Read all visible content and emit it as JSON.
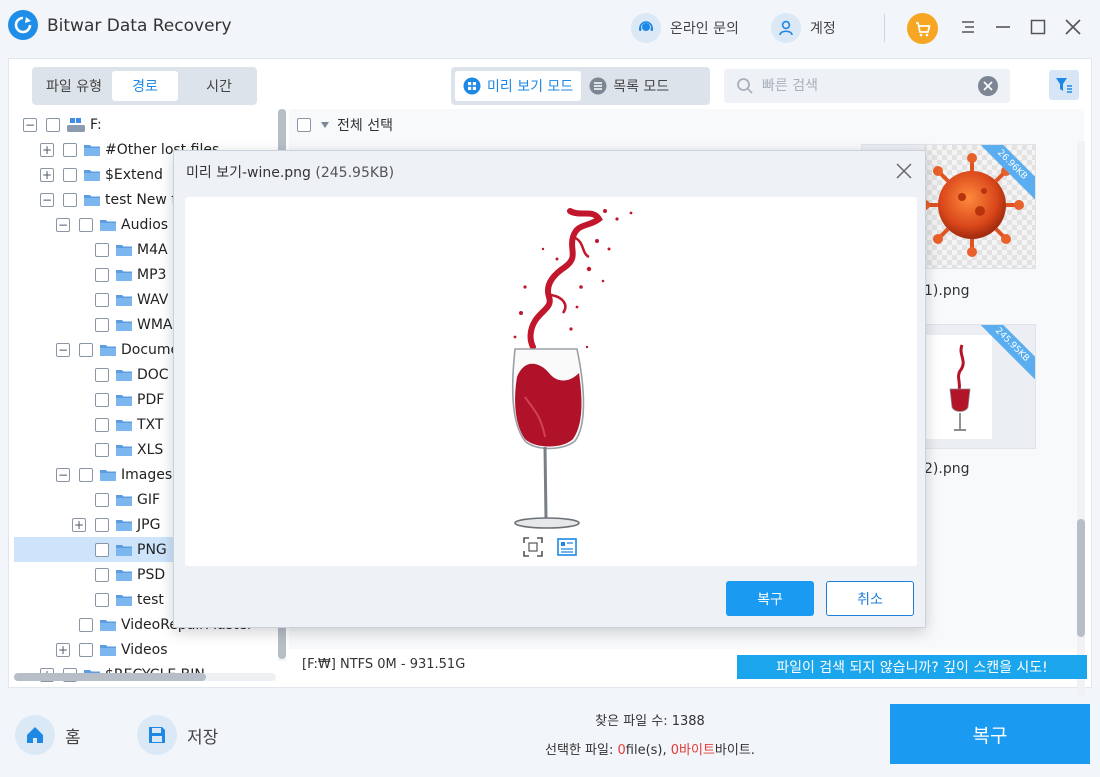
{
  "app": {
    "title": "Bitwar Data Recovery"
  },
  "header": {
    "online_inquiry": "온라인 문의",
    "account": "계정"
  },
  "left_panel": {
    "filter_label": "파일 유형",
    "tabs": [
      {
        "label": "경로"
      },
      {
        "label": "시간"
      }
    ]
  },
  "tree": {
    "items": [
      {
        "label": "F:"
      },
      {
        "label": "#Other lost files"
      },
      {
        "label": "$Extend"
      },
      {
        "label": "test New f"
      },
      {
        "label": "Audios"
      },
      {
        "label": "M4A"
      },
      {
        "label": "MP3"
      },
      {
        "label": "WAV"
      },
      {
        "label": "WMA"
      },
      {
        "label": "Docume"
      },
      {
        "label": "DOC"
      },
      {
        "label": "PDF"
      },
      {
        "label": "TXT"
      },
      {
        "label": "XLS"
      },
      {
        "label": "Images"
      },
      {
        "label": "GIF"
      },
      {
        "label": "JPG"
      },
      {
        "label": "PNG"
      },
      {
        "label": "PSD"
      },
      {
        "label": "test"
      },
      {
        "label": "VideoRepairMaster"
      },
      {
        "label": "Videos"
      },
      {
        "label": "$RECYCLE.BIN"
      }
    ]
  },
  "toolbar": {
    "preview_mode": "미리 보기 모드",
    "list_mode": "목록 모드",
    "search_placeholder": "빠른 검색"
  },
  "content": {
    "select_all": "전체 선택",
    "files": [
      {
        "name": "1).png",
        "size_badge": "26.96KB"
      },
      {
        "name": "2).png",
        "size_badge": "245.95KB"
      }
    ]
  },
  "status": {
    "drive": "[F:₩] NTFS 0M - 931.51G",
    "deep_scan": "파일이 검색 되지 않습니까? 깊이 스캔을 시도!"
  },
  "footer": {
    "home": "홈",
    "save": "저장",
    "found_label": "찾은 파일 수: 1388",
    "selected_prefix": "선택한 파일: ",
    "selected_files": "0",
    "selected_files_unit": "file(s), ",
    "selected_bytes": "0바이트",
    "selected_bytes_unit": "바이트.",
    "recover": "복구"
  },
  "modal": {
    "title": "미리 보기-wine.png",
    "size": "(245.95KB)",
    "recover": "복구",
    "cancel": "취소"
  },
  "colors": {
    "accent": "#1a9af1",
    "selected_row": "#cde4fb",
    "highlight_red": "#e53935",
    "cart": "#f6a623"
  }
}
